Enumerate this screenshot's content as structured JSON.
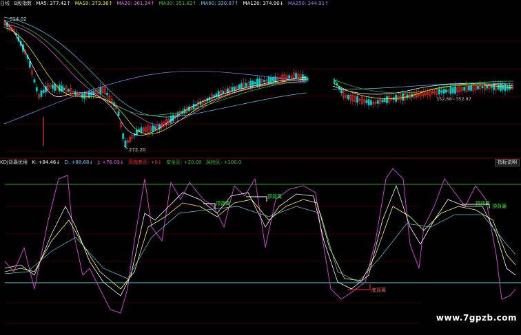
{
  "top": {
    "period": "日线",
    "symbol": "B股指数",
    "ma": [
      {
        "label": "MA5: 377.42↑",
        "color": "#ffffff"
      },
      {
        "label": "MA10: 373.36↑",
        "color": "#ffff00"
      },
      {
        "label": "MA20: 361.24↑",
        "color": "#ff66ff"
      },
      {
        "label": "MA30: 351.82↑",
        "color": "#33cc33"
      },
      {
        "label": "MA60: 330.07↑",
        "color": "#66ccff"
      },
      {
        "label": "MA120: 374.90↓",
        "color": "#ffffff"
      },
      {
        "label": "MA250: 344.91↑",
        "color": "#8888ff"
      }
    ],
    "high_label": "514.02",
    "low_label": "272.20",
    "range_label": "352.68~352.97"
  },
  "bottom": {
    "title": "KDJ背离优用",
    "items": [
      {
        "label": "K: +84.46↓",
        "color": "#ffffff"
      },
      {
        "label": "D: +88.68↓",
        "color": "#66ccff"
      },
      {
        "label": "J: +76.03↓",
        "color": "#ff66ff"
      },
      {
        "label": "高抛参区: +0↓",
        "color": "#ff3333"
      },
      {
        "label": "安全区: +20.00",
        "color": "#33cc33"
      },
      {
        "label": "风险区: +100.0",
        "color": "#33cc33"
      }
    ],
    "button": "指标说明",
    "top_divergence_label": "顶背离",
    "bottom_divergence_label": "底背离"
  },
  "watermark": "www.7gpzb.com",
  "colors": {
    "bg": "#000000",
    "up": "#ff3333",
    "down": "#00cccc",
    "grid": "#7a0000",
    "k": "#ffffff",
    "d": "#ffff66",
    "j": "#cc44cc",
    "line80": "#22aa22",
    "line20": "#66ccdd"
  }
}
